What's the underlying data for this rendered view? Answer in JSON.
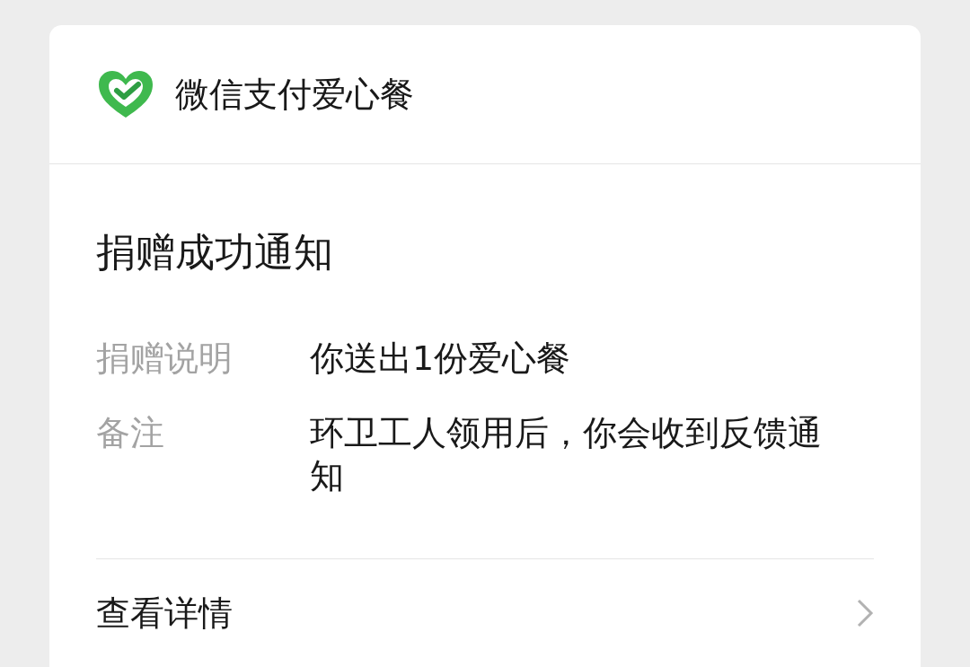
{
  "header": {
    "title": "微信支付爱心餐"
  },
  "notice": {
    "title": "捐赠成功通知",
    "fields": [
      {
        "label": "捐赠说明",
        "value": "你送出1份爱心餐"
      },
      {
        "label": "备注",
        "value": "环卫工人领用后，你会收到反馈通知"
      }
    ]
  },
  "footer": {
    "link": "查看详情"
  }
}
